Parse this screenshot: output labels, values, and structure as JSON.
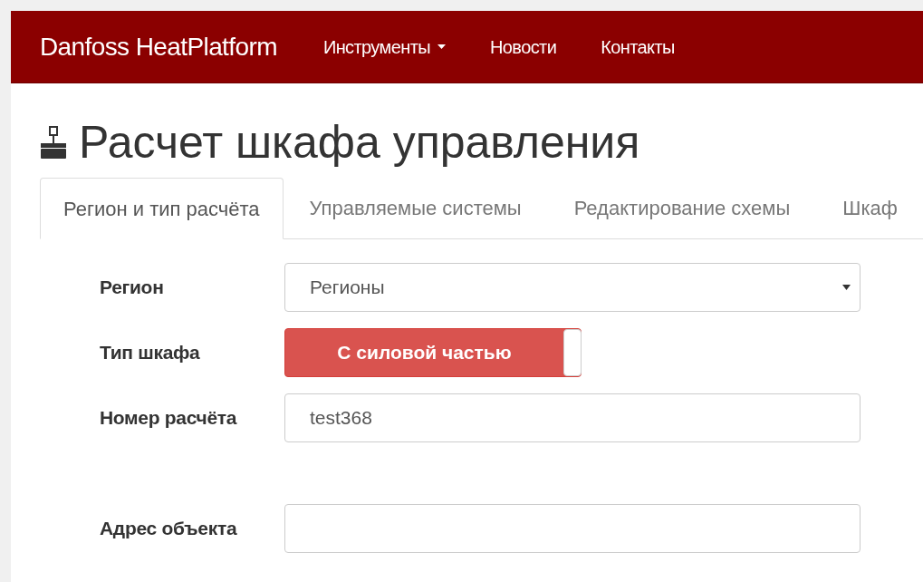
{
  "navbar": {
    "brand": "Danfoss HeatPlatform",
    "items": [
      {
        "label": "Инструменты",
        "dropdown": true
      },
      {
        "label": "Новости",
        "dropdown": false
      },
      {
        "label": "Контакты",
        "dropdown": false
      }
    ]
  },
  "page_title": "Расчет шкафа управления",
  "tabs": [
    {
      "label": "Регион и тип расчёта",
      "selected": true
    },
    {
      "label": "Управляемые системы",
      "selected": false
    },
    {
      "label": "Редактирование схемы",
      "selected": false
    },
    {
      "label": "Шкаф",
      "selected": false
    }
  ],
  "form": [
    {
      "kind": "select",
      "label": "Регион",
      "value": "Регионы"
    },
    {
      "kind": "toggle",
      "label": "Тип шкафа",
      "value": "С силовой частью",
      "on": true
    },
    {
      "kind": "text",
      "label": "Номер расчёта",
      "value": "test368"
    },
    {
      "kind": "spacer"
    },
    {
      "kind": "text",
      "label": "Адрес объекта"
    }
  ]
}
